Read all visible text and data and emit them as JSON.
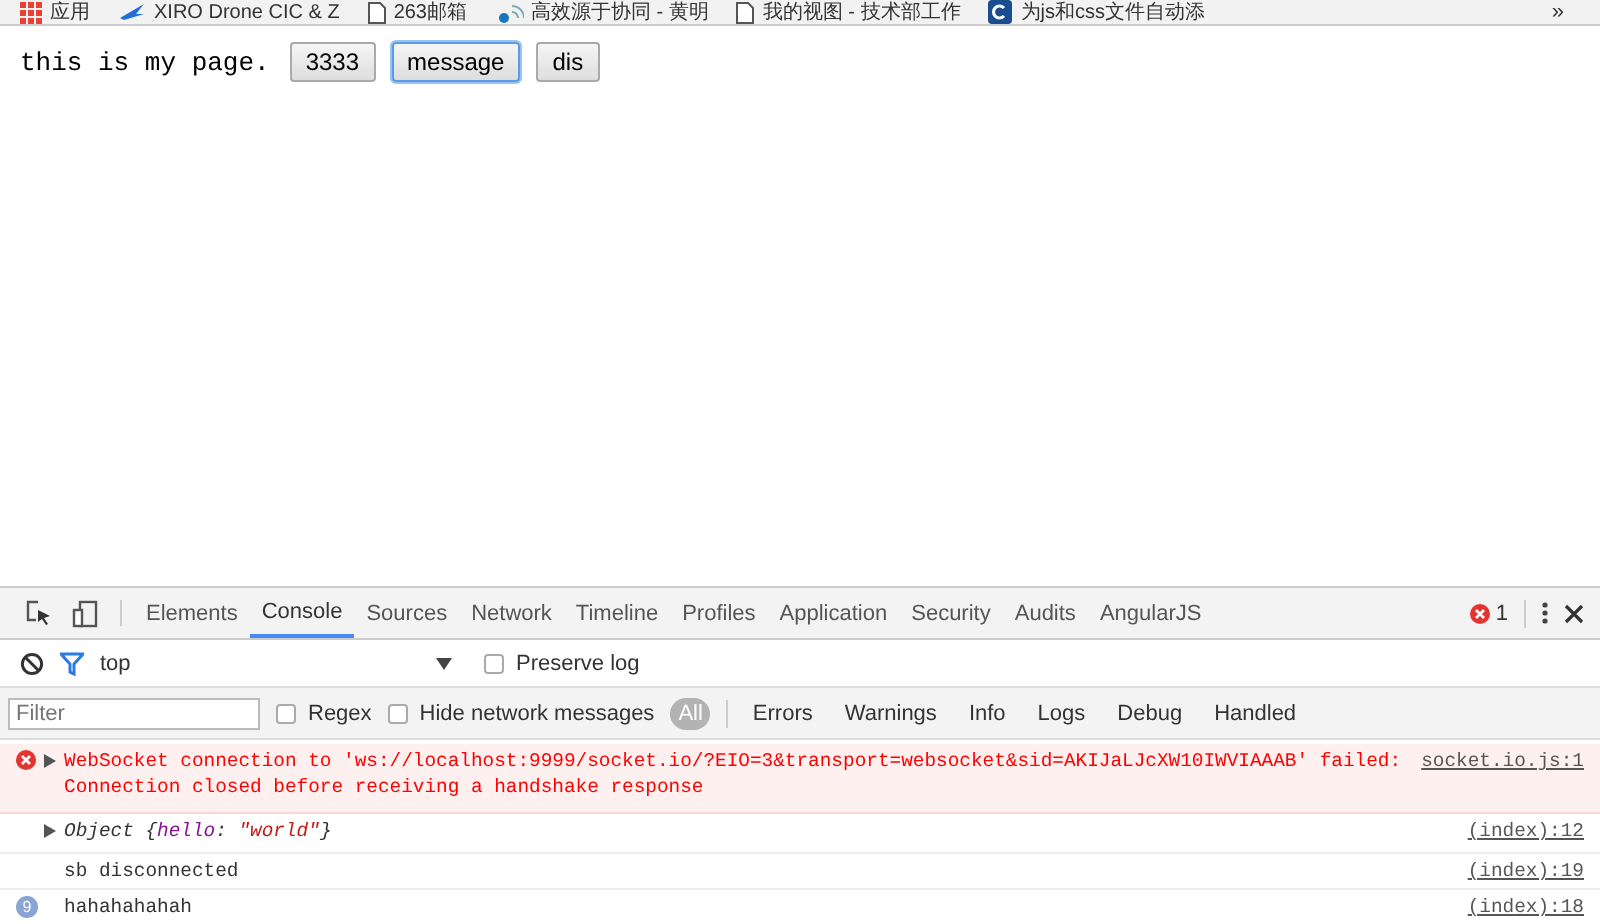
{
  "bookmarks": {
    "items": [
      {
        "label": "应用",
        "kind": "apps"
      },
      {
        "label": "XIRO Drone CIC & Z",
        "kind": "drone"
      },
      {
        "label": "263邮箱",
        "kind": "page"
      },
      {
        "label": "高效源于协同 - 黄明",
        "kind": "signal"
      },
      {
        "label": "我的视图 - 技术部工作",
        "kind": "page"
      },
      {
        "label": "为js和css文件自动添",
        "kind": "logo"
      }
    ],
    "overflow": "»"
  },
  "page": {
    "text": "this is my page.",
    "buttons": [
      {
        "label": "3333",
        "focused": false
      },
      {
        "label": "message",
        "focused": true
      },
      {
        "label": "dis",
        "focused": false
      }
    ]
  },
  "devtools": {
    "tabs": [
      {
        "label": "Elements",
        "selected": false
      },
      {
        "label": "Console",
        "selected": true
      },
      {
        "label": "Sources",
        "selected": false
      },
      {
        "label": "Network",
        "selected": false
      },
      {
        "label": "Timeline",
        "selected": false
      },
      {
        "label": "Profiles",
        "selected": false
      },
      {
        "label": "Application",
        "selected": false
      },
      {
        "label": "Security",
        "selected": false
      },
      {
        "label": "Audits",
        "selected": false
      },
      {
        "label": "AngularJS",
        "selected": false
      }
    ],
    "error_count": "1",
    "context": "top",
    "preserve_log": {
      "label": "Preserve log",
      "checked": false
    },
    "filter": {
      "placeholder": "Filter"
    },
    "regex": {
      "label": "Regex",
      "checked": false
    },
    "hide_network": {
      "label": "Hide network messages",
      "checked": false
    },
    "levels": [
      {
        "label": "All",
        "selected": true
      },
      {
        "label": "Errors",
        "selected": false
      },
      {
        "label": "Warnings",
        "selected": false
      },
      {
        "label": "Info",
        "selected": false
      },
      {
        "label": "Logs",
        "selected": false
      },
      {
        "label": "Debug",
        "selected": false
      },
      {
        "label": "Handled",
        "selected": false
      }
    ],
    "messages": [
      {
        "kind": "error",
        "expandable": true,
        "lines": [
          "WebSocket connection to 'ws://localhost:9999/socket.io/?EIO=3&transport=websocket&sid=AKIJaLJcXW10IWVIAAAB' failed:",
          "Connection closed before receiving a handshake response"
        ],
        "source": "socket.io.js:1"
      },
      {
        "kind": "object",
        "expandable": true,
        "parts": [
          {
            "kind": "plain",
            "text": "Object {"
          },
          {
            "kind": "key",
            "text": "hello"
          },
          {
            "kind": "plain",
            "text": ": "
          },
          {
            "kind": "string",
            "text": "\"world\""
          },
          {
            "kind": "plain",
            "text": "}"
          }
        ],
        "source": "(index):12"
      },
      {
        "kind": "log",
        "expandable": false,
        "lines": [
          "sb disconnected"
        ],
        "source": "(index):19"
      },
      {
        "kind": "log",
        "expandable": false,
        "repeat": "9",
        "lines": [
          "hahahahahah"
        ],
        "source": "(index):18"
      }
    ]
  }
}
